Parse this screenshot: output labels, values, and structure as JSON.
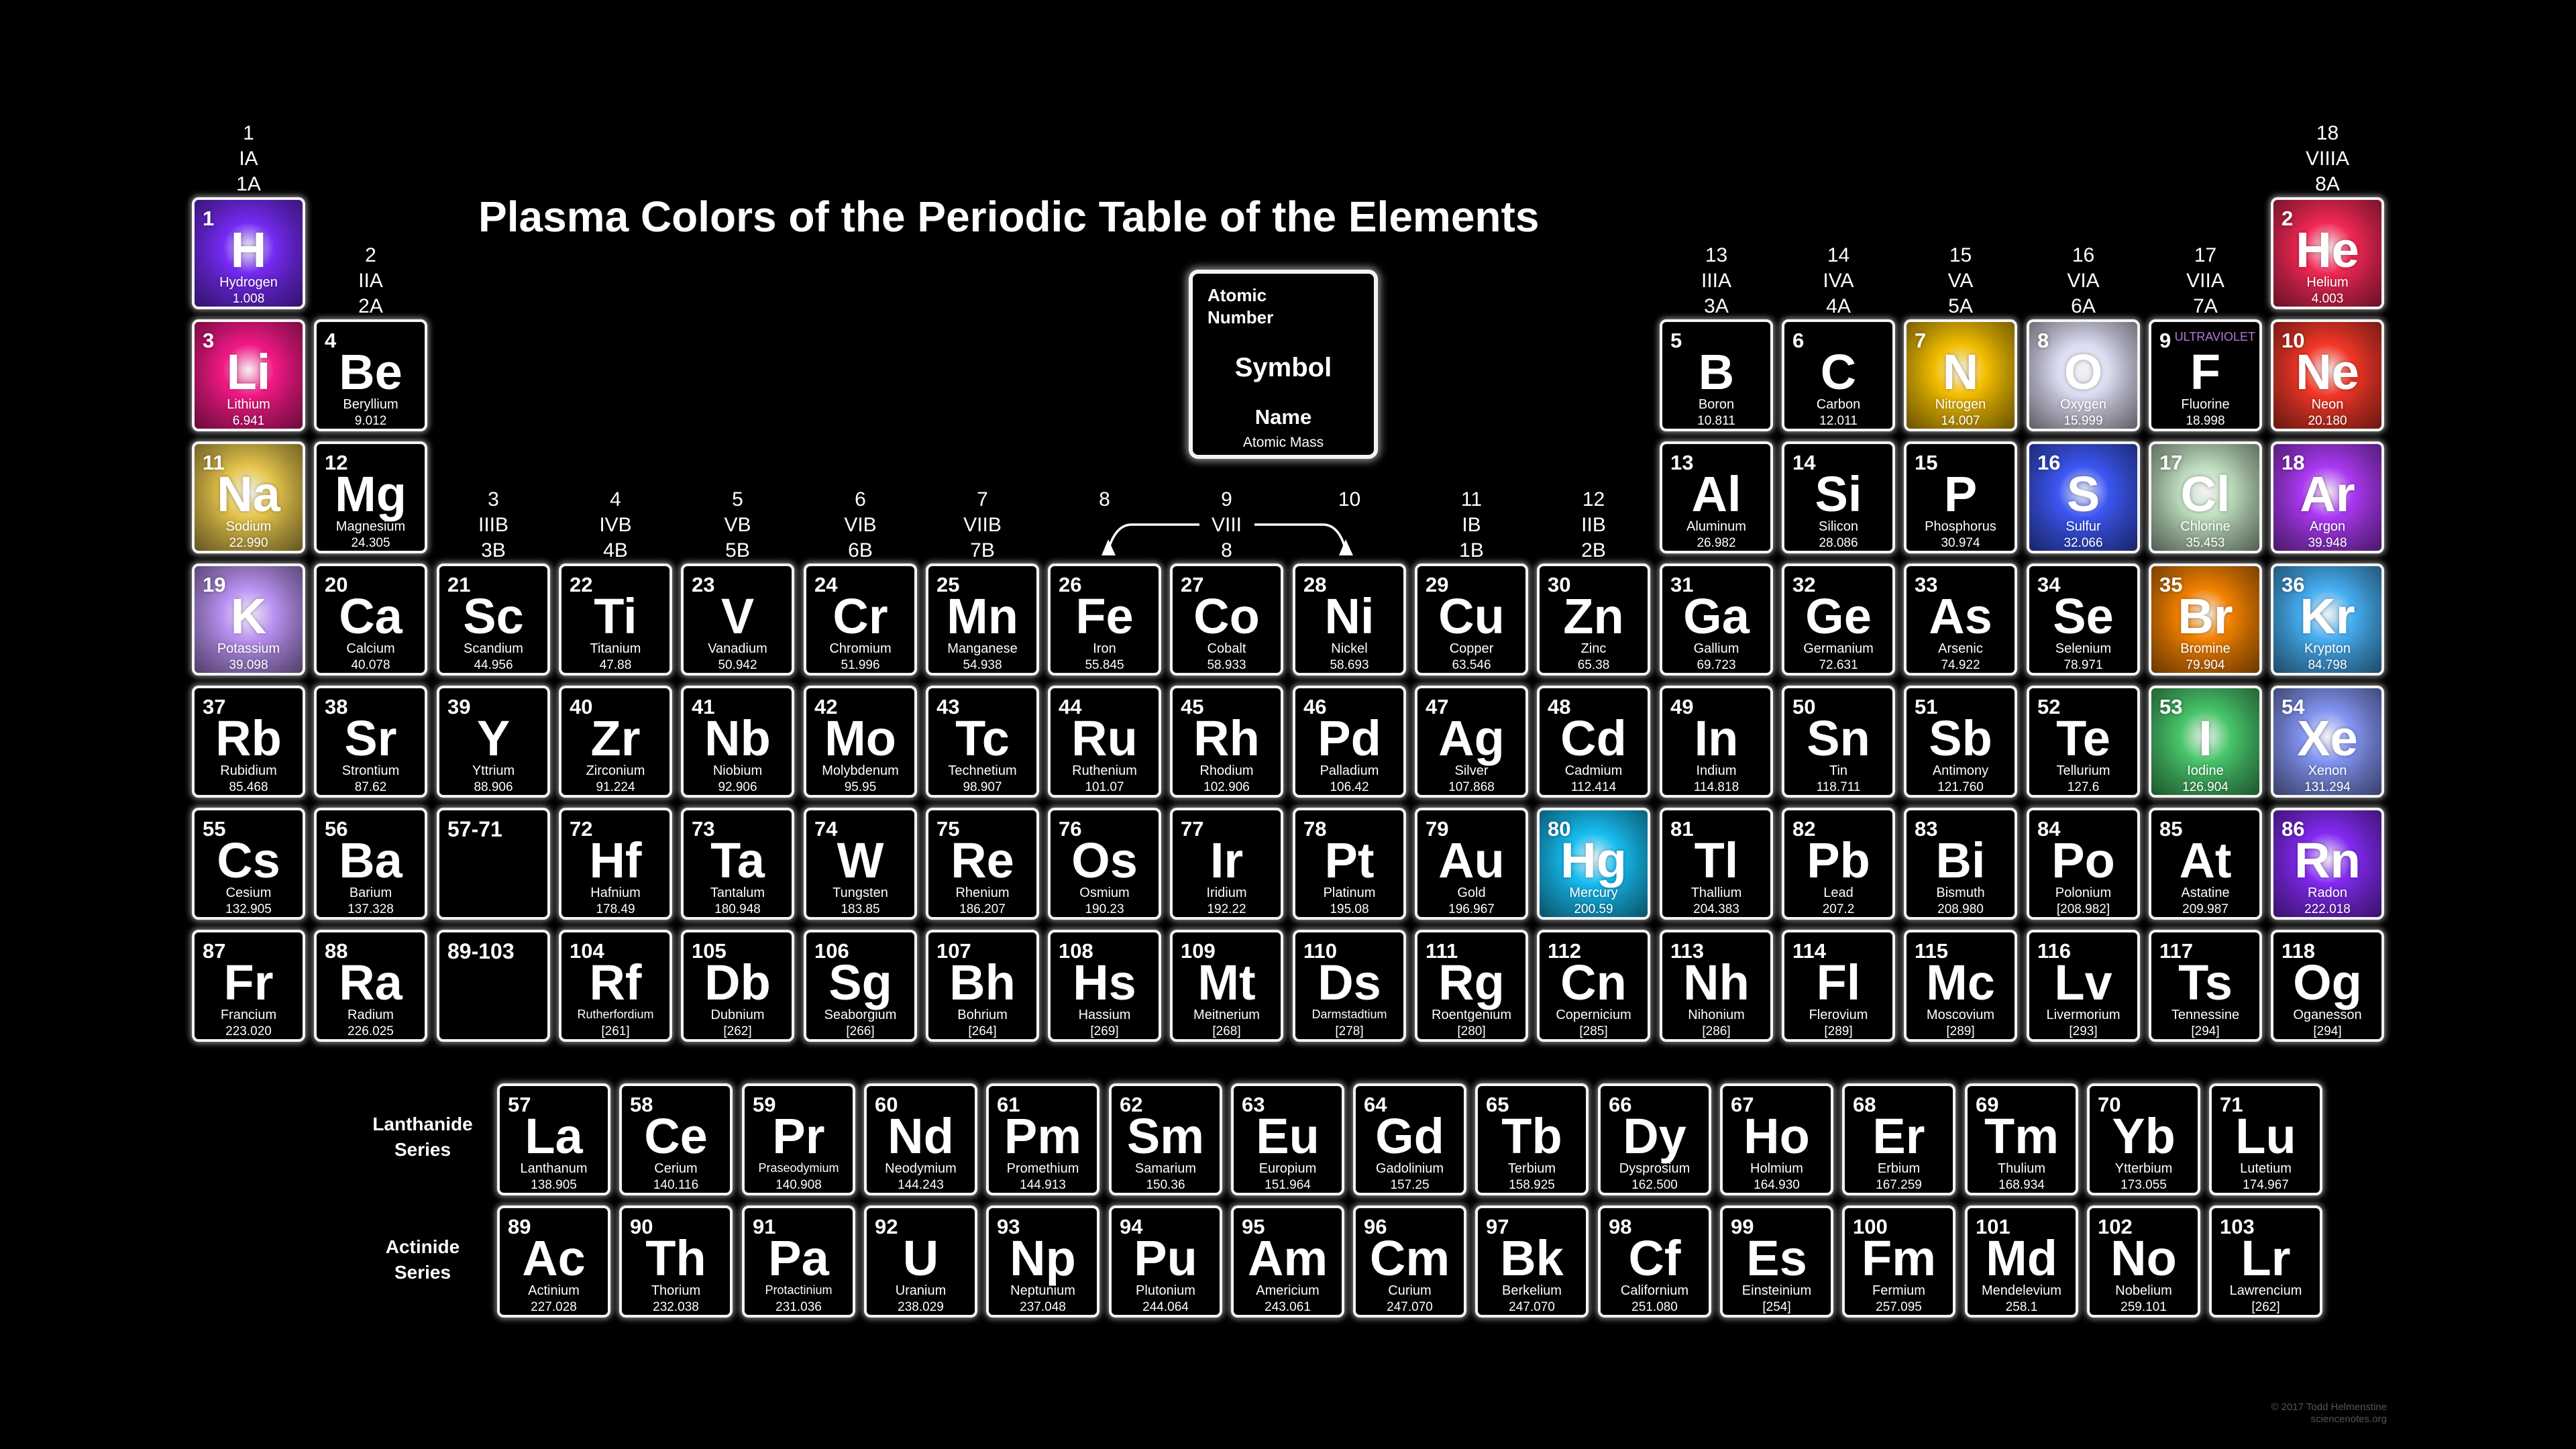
{
  "title": "Plasma Colors of the Periodic Table of the Elements",
  "legend": {
    "atomic_number_label": "Atomic\nNumber",
    "symbol_label": "Symbol",
    "name_label": "Name",
    "mass_label": "Atomic   Mass"
  },
  "group_labels": [
    {
      "id": "g1",
      "lines": [
        "1",
        "IA",
        "1A"
      ]
    },
    {
      "id": "g2",
      "lines": [
        "2",
        "IIA",
        "2A"
      ]
    },
    {
      "id": "g3",
      "lines": [
        "3",
        "IIIB",
        "3B"
      ]
    },
    {
      "id": "g4",
      "lines": [
        "4",
        "IVB",
        "4B"
      ]
    },
    {
      "id": "g5",
      "lines": [
        "5",
        "VB",
        "5B"
      ]
    },
    {
      "id": "g6",
      "lines": [
        "6",
        "VIB",
        "6B"
      ]
    },
    {
      "id": "g7",
      "lines": [
        "7",
        "VIIB",
        "7B"
      ]
    },
    {
      "id": "g8",
      "lines": [
        "8"
      ]
    },
    {
      "id": "g9",
      "lines": [
        "9",
        "VIII",
        "8"
      ]
    },
    {
      "id": "g10",
      "lines": [
        "10"
      ]
    },
    {
      "id": "g11",
      "lines": [
        "11",
        "IB",
        "1B"
      ]
    },
    {
      "id": "g12",
      "lines": [
        "12",
        "IIB",
        "2B"
      ]
    },
    {
      "id": "g13",
      "lines": [
        "13",
        "IIIA",
        "3A"
      ]
    },
    {
      "id": "g14",
      "lines": [
        "14",
        "IVA",
        "4A"
      ]
    },
    {
      "id": "g15",
      "lines": [
        "15",
        "VA",
        "5A"
      ]
    },
    {
      "id": "g16",
      "lines": [
        "16",
        "VIA",
        "6A"
      ]
    },
    {
      "id": "g17",
      "lines": [
        "17",
        "VIIA",
        "7A"
      ]
    },
    {
      "id": "g18",
      "lines": [
        "18",
        "VIIIA",
        "8A"
      ]
    }
  ],
  "series_labels": {
    "lanthanide": "Lanthanide\nSeries",
    "actinide": "Actinide\nSeries"
  },
  "copyright": "© 2017 Todd Helmenstine\nsciencenotes.org",
  "plasma_colors": {
    "H": "#7a2cff",
    "He": "#ff2a5a",
    "Li": "#ff1a8c",
    "N": "#ffc800",
    "O": "#e8e8ff",
    "Ne": "#ff3a2a",
    "Na": "#f2d050",
    "S": "#3f5bff",
    "Cl": "#c8e8c8",
    "Ar": "#b43cff",
    "K": "#c49aff",
    "Br": "#ff8800",
    "Kr": "#4ab8ff",
    "I": "#4cd070",
    "Xe": "#8a9cff",
    "Hg": "#18c8ff",
    "Rn": "#8a2cff"
  },
  "elements": [
    {
      "n": "1",
      "s": "H",
      "name": "Hydrogen",
      "m": "1.008"
    },
    {
      "n": "2",
      "s": "He",
      "name": "Helium",
      "m": "4.003"
    },
    {
      "n": "3",
      "s": "Li",
      "name": "Lithium",
      "m": "6.941"
    },
    {
      "n": "4",
      "s": "Be",
      "name": "Beryllium",
      "m": "9.012"
    },
    {
      "n": "5",
      "s": "B",
      "name": "Boron",
      "m": "10.811"
    },
    {
      "n": "6",
      "s": "C",
      "name": "Carbon",
      "m": "12.011"
    },
    {
      "n": "7",
      "s": "N",
      "name": "Nitrogen",
      "m": "14.007"
    },
    {
      "n": "8",
      "s": "O",
      "name": "Oxygen",
      "m": "15.999"
    },
    {
      "n": "9",
      "s": "F",
      "name": "Fluorine",
      "m": "18.998",
      "note": "ULTRAVIOLET"
    },
    {
      "n": "10",
      "s": "Ne",
      "name": "Neon",
      "m": "20.180"
    },
    {
      "n": "11",
      "s": "Na",
      "name": "Sodium",
      "m": "22.990"
    },
    {
      "n": "12",
      "s": "Mg",
      "name": "Magnesium",
      "m": "24.305"
    },
    {
      "n": "13",
      "s": "Al",
      "name": "Aluminum",
      "m": "26.982"
    },
    {
      "n": "14",
      "s": "Si",
      "name": "Silicon",
      "m": "28.086"
    },
    {
      "n": "15",
      "s": "P",
      "name": "Phosphorus",
      "m": "30.974"
    },
    {
      "n": "16",
      "s": "S",
      "name": "Sulfur",
      "m": "32.066"
    },
    {
      "n": "17",
      "s": "Cl",
      "name": "Chlorine",
      "m": "35.453"
    },
    {
      "n": "18",
      "s": "Ar",
      "name": "Argon",
      "m": "39.948"
    },
    {
      "n": "19",
      "s": "K",
      "name": "Potassium",
      "m": "39.098"
    },
    {
      "n": "20",
      "s": "Ca",
      "name": "Calcium",
      "m": "40.078"
    },
    {
      "n": "21",
      "s": "Sc",
      "name": "Scandium",
      "m": "44.956"
    },
    {
      "n": "22",
      "s": "Ti",
      "name": "Titanium",
      "m": "47.88"
    },
    {
      "n": "23",
      "s": "V",
      "name": "Vanadium",
      "m": "50.942"
    },
    {
      "n": "24",
      "s": "Cr",
      "name": "Chromium",
      "m": "51.996"
    },
    {
      "n": "25",
      "s": "Mn",
      "name": "Manganese",
      "m": "54.938"
    },
    {
      "n": "26",
      "s": "Fe",
      "name": "Iron",
      "m": "55.845"
    },
    {
      "n": "27",
      "s": "Co",
      "name": "Cobalt",
      "m": "58.933"
    },
    {
      "n": "28",
      "s": "Ni",
      "name": "Nickel",
      "m": "58.693"
    },
    {
      "n": "29",
      "s": "Cu",
      "name": "Copper",
      "m": "63.546"
    },
    {
      "n": "30",
      "s": "Zn",
      "name": "Zinc",
      "m": "65.38"
    },
    {
      "n": "31",
      "s": "Ga",
      "name": "Gallium",
      "m": "69.723"
    },
    {
      "n": "32",
      "s": "Ge",
      "name": "Germanium",
      "m": "72.631"
    },
    {
      "n": "33",
      "s": "As",
      "name": "Arsenic",
      "m": "74.922"
    },
    {
      "n": "34",
      "s": "Se",
      "name": "Selenium",
      "m": "78.971"
    },
    {
      "n": "35",
      "s": "Br",
      "name": "Bromine",
      "m": "79.904"
    },
    {
      "n": "36",
      "s": "Kr",
      "name": "Krypton",
      "m": "84.798"
    },
    {
      "n": "37",
      "s": "Rb",
      "name": "Rubidium",
      "m": "85.468"
    },
    {
      "n": "38",
      "s": "Sr",
      "name": "Strontium",
      "m": "87.62"
    },
    {
      "n": "39",
      "s": "Y",
      "name": "Yttrium",
      "m": "88.906"
    },
    {
      "n": "40",
      "s": "Zr",
      "name": "Zirconium",
      "m": "91.224"
    },
    {
      "n": "41",
      "s": "Nb",
      "name": "Niobium",
      "m": "92.906"
    },
    {
      "n": "42",
      "s": "Mo",
      "name": "Molybdenum",
      "m": "95.95"
    },
    {
      "n": "43",
      "s": "Tc",
      "name": "Technetium",
      "m": "98.907"
    },
    {
      "n": "44",
      "s": "Ru",
      "name": "Ruthenium",
      "m": "101.07"
    },
    {
      "n": "45",
      "s": "Rh",
      "name": "Rhodium",
      "m": "102.906"
    },
    {
      "n": "46",
      "s": "Pd",
      "name": "Palladium",
      "m": "106.42"
    },
    {
      "n": "47",
      "s": "Ag",
      "name": "Silver",
      "m": "107.868"
    },
    {
      "n": "48",
      "s": "Cd",
      "name": "Cadmium",
      "m": "112.414"
    },
    {
      "n": "49",
      "s": "In",
      "name": "Indium",
      "m": "114.818"
    },
    {
      "n": "50",
      "s": "Sn",
      "name": "Tin",
      "m": "118.711"
    },
    {
      "n": "51",
      "s": "Sb",
      "name": "Antimony",
      "m": "121.760"
    },
    {
      "n": "52",
      "s": "Te",
      "name": "Tellurium",
      "m": "127.6"
    },
    {
      "n": "53",
      "s": "I",
      "name": "Iodine",
      "m": "126.904"
    },
    {
      "n": "54",
      "s": "Xe",
      "name": "Xenon",
      "m": "131.294"
    },
    {
      "n": "55",
      "s": "Cs",
      "name": "Cesium",
      "m": "132.905"
    },
    {
      "n": "56",
      "s": "Ba",
      "name": "Barium",
      "m": "137.328"
    },
    {
      "n": "57-71",
      "s": "",
      "name": "",
      "m": ""
    },
    {
      "n": "72",
      "s": "Hf",
      "name": "Hafnium",
      "m": "178.49"
    },
    {
      "n": "73",
      "s": "Ta",
      "name": "Tantalum",
      "m": "180.948"
    },
    {
      "n": "74",
      "s": "W",
      "name": "Tungsten",
      "m": "183.85"
    },
    {
      "n": "75",
      "s": "Re",
      "name": "Rhenium",
      "m": "186.207"
    },
    {
      "n": "76",
      "s": "Os",
      "name": "Osmium",
      "m": "190.23"
    },
    {
      "n": "77",
      "s": "Ir",
      "name": "Iridium",
      "m": "192.22"
    },
    {
      "n": "78",
      "s": "Pt",
      "name": "Platinum",
      "m": "195.08"
    },
    {
      "n": "79",
      "s": "Au",
      "name": "Gold",
      "m": "196.967"
    },
    {
      "n": "80",
      "s": "Hg",
      "name": "Mercury",
      "m": "200.59"
    },
    {
      "n": "81",
      "s": "Tl",
      "name": "Thallium",
      "m": "204.383"
    },
    {
      "n": "82",
      "s": "Pb",
      "name": "Lead",
      "m": "207.2"
    },
    {
      "n": "83",
      "s": "Bi",
      "name": "Bismuth",
      "m": "208.980"
    },
    {
      "n": "84",
      "s": "Po",
      "name": "Polonium",
      "m": "[208.982]"
    },
    {
      "n": "85",
      "s": "At",
      "name": "Astatine",
      "m": "209.987"
    },
    {
      "n": "86",
      "s": "Rn",
      "name": "Radon",
      "m": "222.018"
    },
    {
      "n": "87",
      "s": "Fr",
      "name": "Francium",
      "m": "223.020"
    },
    {
      "n": "88",
      "s": "Ra",
      "name": "Radium",
      "m": "226.025"
    },
    {
      "n": "89-103",
      "s": "",
      "name": "",
      "m": ""
    },
    {
      "n": "104",
      "s": "Rf",
      "name": "Rutherfordium",
      "m": "[261]"
    },
    {
      "n": "105",
      "s": "Db",
      "name": "Dubnium",
      "m": "[262]"
    },
    {
      "n": "106",
      "s": "Sg",
      "name": "Seaborgium",
      "m": "[266]"
    },
    {
      "n": "107",
      "s": "Bh",
      "name": "Bohrium",
      "m": "[264]"
    },
    {
      "n": "108",
      "s": "Hs",
      "name": "Hassium",
      "m": "[269]"
    },
    {
      "n": "109",
      "s": "Mt",
      "name": "Meitnerium",
      "m": "[268]"
    },
    {
      "n": "110",
      "s": "Ds",
      "name": "Darmstadtium",
      "m": "[278]"
    },
    {
      "n": "111",
      "s": "Rg",
      "name": "Roentgenium",
      "m": "[280]"
    },
    {
      "n": "112",
      "s": "Cn",
      "name": "Copernicium",
      "m": "[285]"
    },
    {
      "n": "113",
      "s": "Nh",
      "name": "Nihonium",
      "m": "[286]"
    },
    {
      "n": "114",
      "s": "Fl",
      "name": "Flerovium",
      "m": "[289]"
    },
    {
      "n": "115",
      "s": "Mc",
      "name": "Moscovium",
      "m": "[289]"
    },
    {
      "n": "116",
      "s": "Lv",
      "name": "Livermorium",
      "m": "[293]"
    },
    {
      "n": "117",
      "s": "Ts",
      "name": "Tennessine",
      "m": "[294]"
    },
    {
      "n": "118",
      "s": "Og",
      "name": "Oganesson",
      "m": "[294]"
    }
  ],
  "lanthanides": [
    {
      "n": "57",
      "s": "La",
      "name": "Lanthanum",
      "m": "138.905"
    },
    {
      "n": "58",
      "s": "Ce",
      "name": "Cerium",
      "m": "140.116"
    },
    {
      "n": "59",
      "s": "Pr",
      "name": "Praseodymium",
      "m": "140.908"
    },
    {
      "n": "60",
      "s": "Nd",
      "name": "Neodymium",
      "m": "144.243"
    },
    {
      "n": "61",
      "s": "Pm",
      "name": "Promethium",
      "m": "144.913"
    },
    {
      "n": "62",
      "s": "Sm",
      "name": "Samarium",
      "m": "150.36"
    },
    {
      "n": "63",
      "s": "Eu",
      "name": "Europium",
      "m": "151.964"
    },
    {
      "n": "64",
      "s": "Gd",
      "name": "Gadolinium",
      "m": "157.25"
    },
    {
      "n": "65",
      "s": "Tb",
      "name": "Terbium",
      "m": "158.925"
    },
    {
      "n": "66",
      "s": "Dy",
      "name": "Dysprosium",
      "m": "162.500"
    },
    {
      "n": "67",
      "s": "Ho",
      "name": "Holmium",
      "m": "164.930"
    },
    {
      "n": "68",
      "s": "Er",
      "name": "Erbium",
      "m": "167.259"
    },
    {
      "n": "69",
      "s": "Tm",
      "name": "Thulium",
      "m": "168.934"
    },
    {
      "n": "70",
      "s": "Yb",
      "name": "Ytterbium",
      "m": "173.055"
    },
    {
      "n": "71",
      "s": "Lu",
      "name": "Lutetium",
      "m": "174.967"
    }
  ],
  "actinides": [
    {
      "n": "89",
      "s": "Ac",
      "name": "Actinium",
      "m": "227.028"
    },
    {
      "n": "90",
      "s": "Th",
      "name": "Thorium",
      "m": "232.038"
    },
    {
      "n": "91",
      "s": "Pa",
      "name": "Protactinium",
      "m": "231.036"
    },
    {
      "n": "92",
      "s": "U",
      "name": "Uranium",
      "m": "238.029"
    },
    {
      "n": "93",
      "s": "Np",
      "name": "Neptunium",
      "m": "237.048"
    },
    {
      "n": "94",
      "s": "Pu",
      "name": "Plutonium",
      "m": "244.064"
    },
    {
      "n": "95",
      "s": "Am",
      "name": "Americium",
      "m": "243.061"
    },
    {
      "n": "96",
      "s": "Cm",
      "name": "Curium",
      "m": "247.070"
    },
    {
      "n": "97",
      "s": "Bk",
      "name": "Berkelium",
      "m": "247.070"
    },
    {
      "n": "98",
      "s": "Cf",
      "name": "Californium",
      "m": "251.080"
    },
    {
      "n": "99",
      "s": "Es",
      "name": "Einsteinium",
      "m": "[254]"
    },
    {
      "n": "100",
      "s": "Fm",
      "name": "Fermium",
      "m": "257.095"
    },
    {
      "n": "101",
      "s": "Md",
      "name": "Mendelevium",
      "m": "258.1"
    },
    {
      "n": "102",
      "s": "No",
      "name": "Nobelium",
      "m": "259.101"
    },
    {
      "n": "103",
      "s": "Lr",
      "name": "Lawrencium",
      "m": "[262]"
    }
  ]
}
